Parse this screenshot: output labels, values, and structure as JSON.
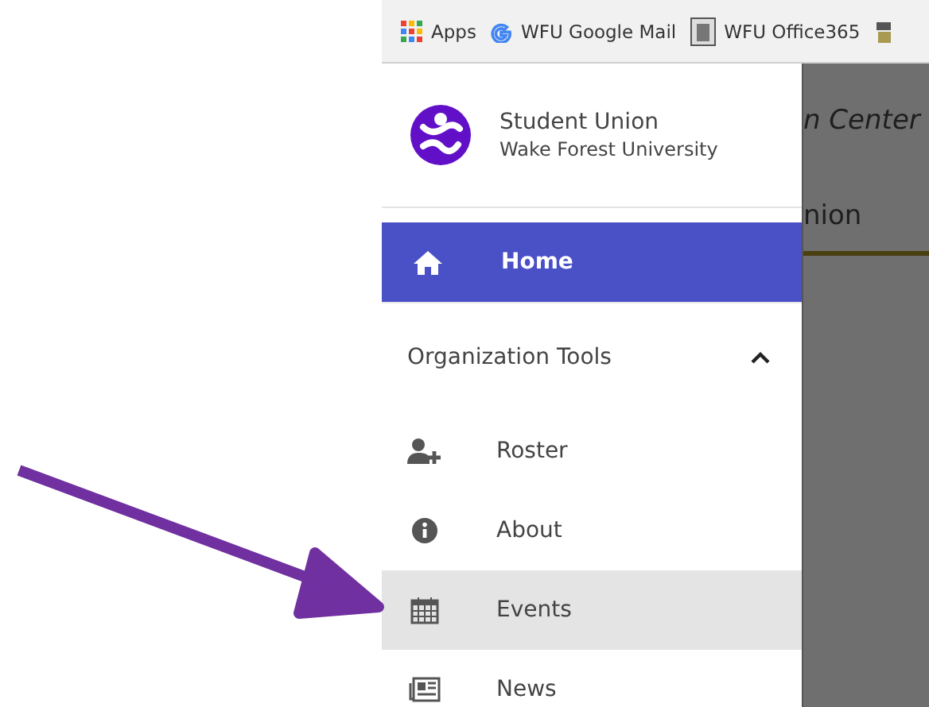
{
  "bookmarks": [
    {
      "kind": "apps",
      "label": "Apps"
    },
    {
      "kind": "google",
      "label": "WFU Google Mail"
    },
    {
      "kind": "image",
      "label": "WFU Office365"
    },
    {
      "kind": "partial"
    }
  ],
  "sidebar": {
    "title": "Student Union",
    "subtitle": "Wake Forest University",
    "home": {
      "label": "Home",
      "active": true
    },
    "section": {
      "label": "Organization Tools",
      "expanded": true,
      "items": [
        {
          "kind": "roster",
          "label": "Roster",
          "hovered": false
        },
        {
          "kind": "about",
          "label": "About",
          "hovered": false
        },
        {
          "kind": "events",
          "label": "Events",
          "hovered": true
        },
        {
          "kind": "news",
          "label": "News",
          "hovered": false
        }
      ]
    }
  },
  "background": {
    "heading": "n Center",
    "tab": "nion"
  }
}
